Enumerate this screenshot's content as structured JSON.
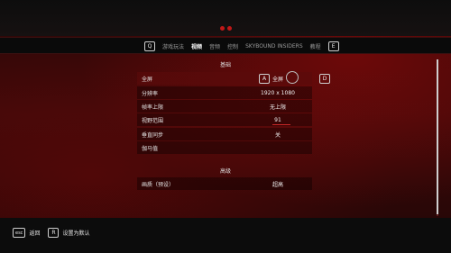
{
  "tabs": {
    "left_key": "Q",
    "right_key": "E",
    "items": [
      {
        "label": "游戏玩法",
        "active": false
      },
      {
        "label": "视频",
        "active": true
      },
      {
        "label": "音频",
        "active": false
      },
      {
        "label": "控制",
        "active": false
      },
      {
        "label": "SKYBOUND INSIDERS",
        "active": false
      },
      {
        "label": "教程",
        "active": false
      }
    ]
  },
  "sections": {
    "basic_title": "基础",
    "advanced_title": "高级"
  },
  "basic_settings": [
    {
      "label": "全屏",
      "value": "全屏",
      "selected": true
    },
    {
      "label": "分辨率",
      "value": "1920 x 1080"
    },
    {
      "label": "帧率上限",
      "value": "无上限"
    },
    {
      "label": "视野范围",
      "value": "91",
      "level": 0.5
    },
    {
      "label": "垂直同步",
      "value": "关"
    },
    {
      "label": "伽马值",
      "value": ""
    }
  ],
  "selector_keys": {
    "prev": "A",
    "next": "D"
  },
  "advanced_settings": [
    {
      "label": "画质（预设）",
      "value": "超高"
    }
  ],
  "footer": {
    "back_key": "esc",
    "back_label": "返回",
    "reset_key": "R",
    "reset_label": "设置为默认"
  },
  "colors": {
    "accent": "#c01818",
    "background": "#3b0909"
  }
}
